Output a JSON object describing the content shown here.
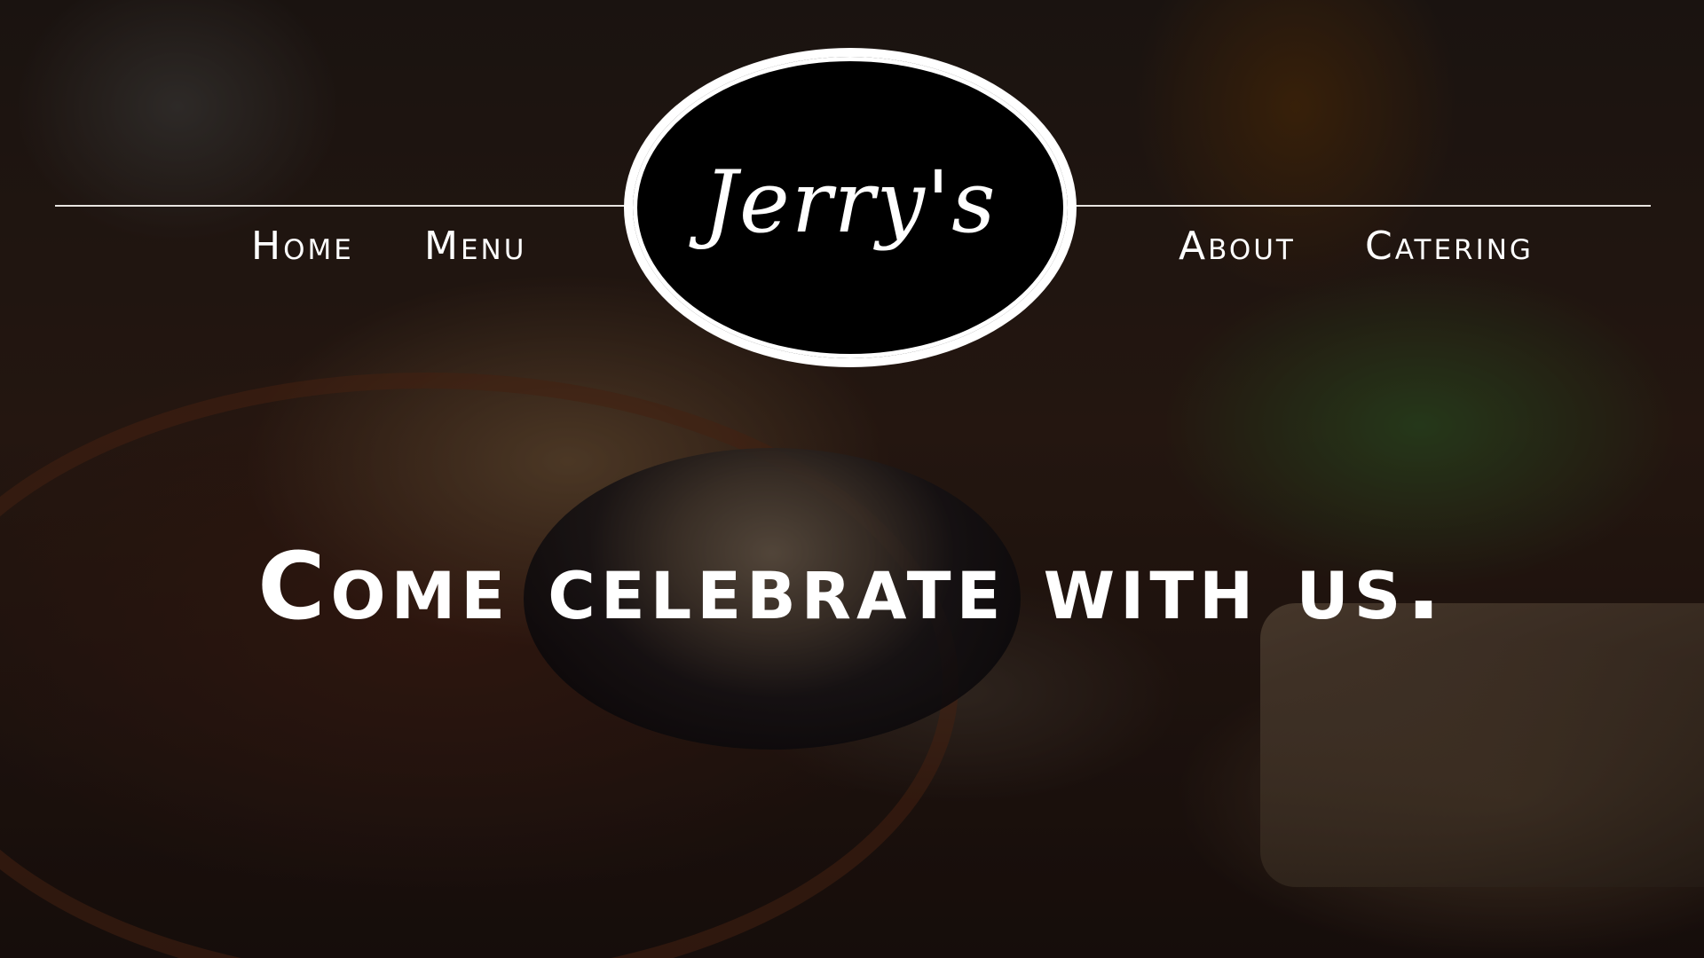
{
  "nav": {
    "home_label": "Home",
    "menu_label": "Menu",
    "about_label": "About",
    "catering_label": "Catering"
  },
  "logo": {
    "text": "Jerry's"
  },
  "hero": {
    "tagline": "Come celebrate with us.",
    "background_image": "food-platter-photo"
  },
  "colors": {
    "text": "#ffffff",
    "logo_fill": "#000000",
    "logo_border": "#ffffff",
    "rule": "#e8e4e0"
  }
}
